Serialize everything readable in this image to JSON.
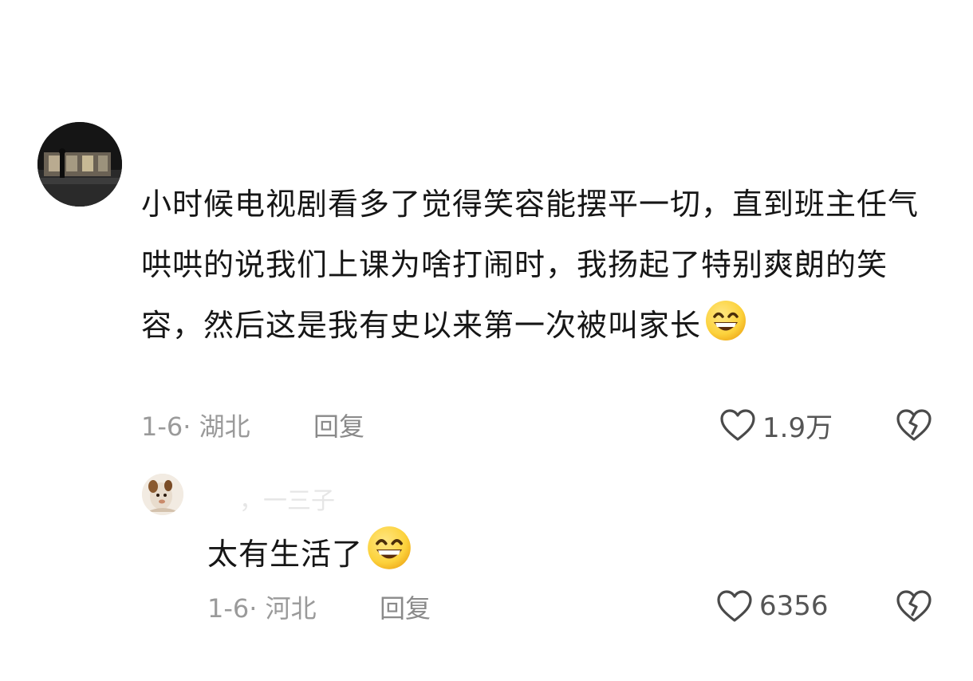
{
  "comment": {
    "text": "小时候电视剧看多了觉得笑容能摆平一切，直到班主任气哄哄的说我们上课为啥打闹时，我扬起了特别爽朗的笑容，然后这是我有史以来第一次被叫家长",
    "emoji": "grinning-face-emoji",
    "meta": "1-6· 湖北",
    "reply_label": "回复",
    "likes": "1.9万"
  },
  "reply": {
    "username": "，一三子",
    "text": "太有生活了",
    "emoji": "grinning-face-emoji",
    "meta": "1-6· 河北",
    "reply_label": "回复",
    "likes": "6356"
  },
  "colors": {
    "text": "#161616",
    "meta": "#9a9a9a",
    "icon": "#555555",
    "emoji_face": "#fcd23c"
  }
}
